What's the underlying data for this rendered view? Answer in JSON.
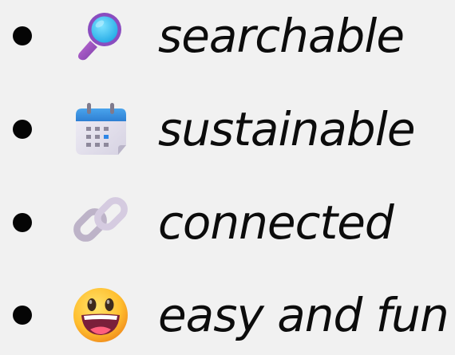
{
  "items": [
    {
      "icon": "magnifying-glass-icon",
      "label": "searchable"
    },
    {
      "icon": "calendar-icon",
      "label": "sustainable"
    },
    {
      "icon": "link-icon",
      "label": "connected"
    },
    {
      "icon": "grinning-face-icon",
      "label": "easy and fun"
    }
  ],
  "colors": {
    "background": "#f1f1f1",
    "text": "#0c0c0c",
    "bullet": "#050505"
  }
}
